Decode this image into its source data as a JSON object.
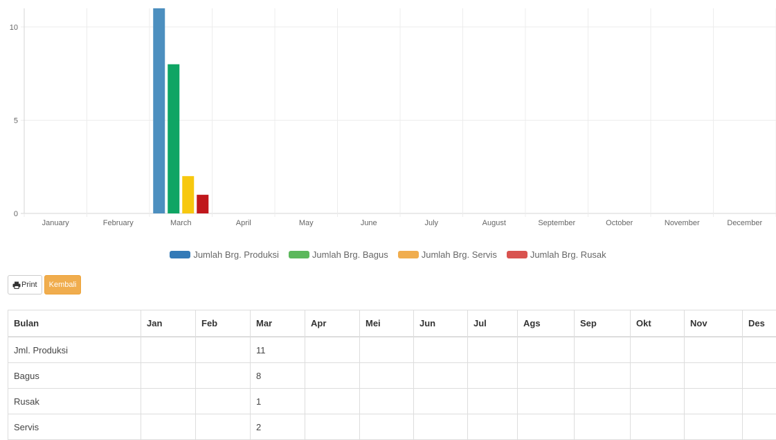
{
  "chart_data": {
    "type": "bar",
    "categories": [
      "January",
      "February",
      "March",
      "April",
      "May",
      "June",
      "July",
      "August",
      "September",
      "October",
      "November",
      "December"
    ],
    "series": [
      {
        "name": "Jumlah Brg. Produksi",
        "color": "#4c8fbf",
        "values": [
          0,
          0,
          11,
          0,
          0,
          0,
          0,
          0,
          0,
          0,
          0,
          0
        ]
      },
      {
        "name": "Jumlah Brg. Bagus",
        "color": "#0fa564",
        "values": [
          0,
          0,
          8,
          0,
          0,
          0,
          0,
          0,
          0,
          0,
          0,
          0
        ]
      },
      {
        "name": "Jumlah Brg. Servis",
        "color": "#f7c80f",
        "values": [
          0,
          0,
          2,
          0,
          0,
          0,
          0,
          0,
          0,
          0,
          0,
          0
        ]
      },
      {
        "name": "Jumlah Brg. Rusak",
        "color": "#c0181c",
        "values": [
          0,
          0,
          1,
          0,
          0,
          0,
          0,
          0,
          0,
          0,
          0,
          0
        ]
      }
    ],
    "yticks": [
      0,
      5,
      10
    ],
    "ylim": [
      0,
      11
    ],
    "grid": true,
    "legend_position": "bottom"
  },
  "legend": [
    {
      "label": "Jumlah Brg. Produksi",
      "color": "#337ab7"
    },
    {
      "label": "Jumlah Brg. Bagus",
      "color": "#5cb85c"
    },
    {
      "label": "Jumlah Brg. Servis",
      "color": "#f0ad4e"
    },
    {
      "label": "Jumlah Brg. Rusak",
      "color": "#d9534f"
    }
  ],
  "buttons": {
    "print_label": "Print",
    "print_icon": "printer-icon",
    "back_label": "Kembali"
  },
  "table": {
    "headers": [
      "Bulan",
      "Jan",
      "Feb",
      "Mar",
      "Apr",
      "Mei",
      "Jun",
      "Jul",
      "Ags",
      "Sep",
      "Okt",
      "Nov",
      "Des"
    ],
    "rows": [
      [
        "Jml. Produksi",
        "",
        "",
        "11",
        "",
        "",
        "",
        "",
        "",
        "",
        "",
        "",
        ""
      ],
      [
        "Bagus",
        "",
        "",
        "8",
        "",
        "",
        "",
        "",
        "",
        "",
        "",
        "",
        ""
      ],
      [
        "Rusak",
        "",
        "",
        "1",
        "",
        "",
        "",
        "",
        "",
        "",
        "",
        "",
        ""
      ],
      [
        "Servis",
        "",
        "",
        "2",
        "",
        "",
        "",
        "",
        "",
        "",
        "",
        "",
        ""
      ]
    ]
  }
}
